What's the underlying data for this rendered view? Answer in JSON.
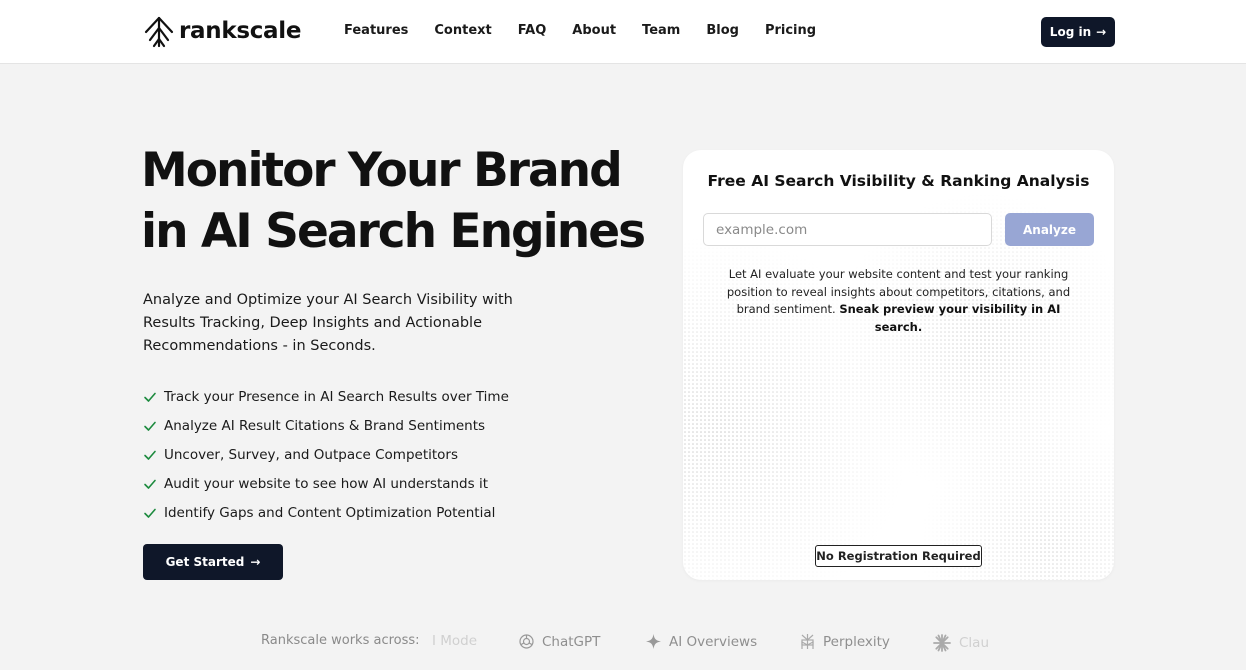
{
  "brand": {
    "name": "rankscale"
  },
  "nav": {
    "items": [
      "Features",
      "Context",
      "FAQ",
      "About",
      "Team",
      "Blog",
      "Pricing"
    ],
    "login_label": "Log in",
    "login_arrow": "→"
  },
  "hero": {
    "title_line1": "Monitor Your Brand",
    "title_line2": "in AI Search Engines",
    "subtitle": "Analyze and Optimize your AI Search Visibility with Results Tracking, Deep Insights and Actionable Recommendations - in Seconds.",
    "features": [
      "Track your Presence in AI Search Results over Time",
      "Analyze AI Result Citations & Brand Sentiments",
      "Uncover, Survey, and Outpace Competitors",
      "Audit your website to see how AI understands it",
      "Identify Gaps and Content Optimization Potential"
    ],
    "cta_label": "Get Started",
    "cta_arrow": "→"
  },
  "card": {
    "title": "Free AI Search Visibility & Ranking Analysis",
    "input_placeholder": "example.com",
    "input_value": "",
    "analyze_label": "Analyze",
    "description": "Let AI evaluate your website content and test your ranking position to reveal insights about competitors, citations, and brand sentiment.",
    "description_bold": "Sneak preview your visibility in AI search.",
    "badge": "No Registration Required"
  },
  "works_across": {
    "label": "Rankscale works across:",
    "engines": [
      "AI Mode",
      "ChatGPT",
      "AI Overviews",
      "Perplexity",
      "Claude"
    ],
    "visible_fragments": {
      "first": "I Mode",
      "last": "Clau"
    }
  },
  "colors": {
    "primary_dark": "#0f1729",
    "analyze_disabled": "#98a6d4",
    "page_bg": "#f3f3f3",
    "check_green": "#1c8a3e"
  },
  "icons": {
    "logo": "rankscale-tree-icon",
    "check": "check-icon",
    "arrow": "arrow-right-icon",
    "chatgpt": "chatgpt-icon",
    "ai_overviews": "sparkle-icon",
    "perplexity": "perplexity-icon",
    "claude": "claude-icon"
  }
}
